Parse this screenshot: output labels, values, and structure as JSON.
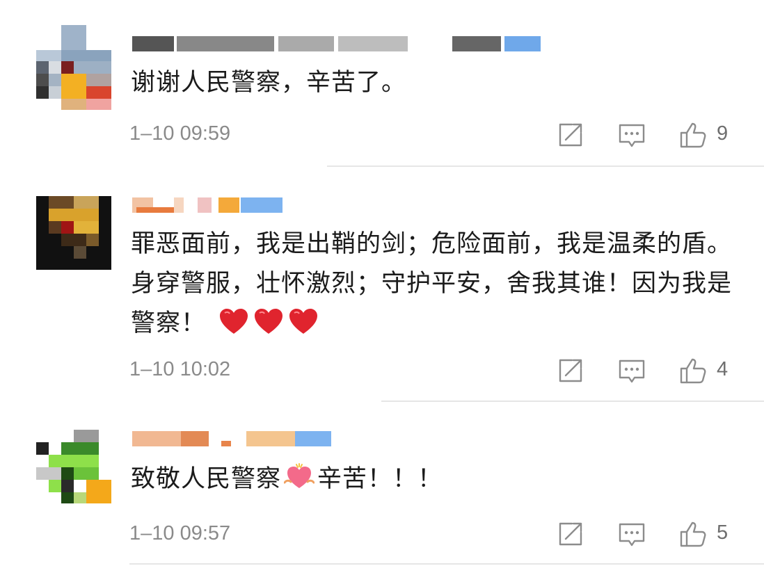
{
  "comments": [
    {
      "text": "谢谢人民警察，辛苦了。",
      "time": "1–10 09:59",
      "likes": "9",
      "nickname_hidden": true
    },
    {
      "text": "罪恶面前，我是出鞘的剑；危险面前，我是温柔的盾。身穿警服，壮怀激烈；守护平安，舍我其谁！因为我是警察！",
      "emoji": [
        "red-heart",
        "red-heart",
        "red-heart"
      ],
      "time": "1–10 10:02",
      "likes": "4",
      "nickname_hidden": true
    },
    {
      "text_before": "致敬人民警察",
      "text_after": "辛苦！！！",
      "emoji": [
        "heart-with-arms"
      ],
      "time": "1–10 09:57",
      "likes": "5",
      "nickname_hidden": true
    }
  ],
  "icons": {
    "repost": "repost-icon",
    "comment": "comment-icon",
    "like": "thumbs-up-icon"
  },
  "colors": {
    "text": "#1b1b1b",
    "meta": "#8a8a8a",
    "icon": "#8c8c8c",
    "heart": "#e0242e",
    "divider": "#e6e6e6"
  }
}
